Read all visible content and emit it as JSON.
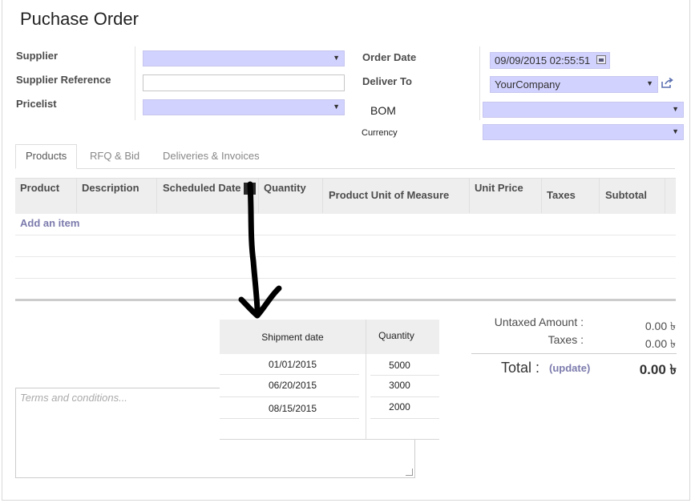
{
  "header": {
    "title": "Puchase Order"
  },
  "form": {
    "supplier_label": "Supplier",
    "supplier_ref_label": "Supplier Reference",
    "pricelist_label": "Pricelist",
    "order_date_label": "Order Date",
    "order_date_value": "09/09/2015 02:55:51",
    "deliver_to_label": "Deliver To",
    "deliver_to_value": "YourCompany",
    "bom_label": "BOM",
    "currency_label": "Currency"
  },
  "tabs": [
    "Products",
    "RFQ & Bid",
    "Deliveries & Invoices"
  ],
  "table": {
    "columns": [
      "Product",
      "Description",
      "Scheduled Date",
      "Quantity",
      "Product Unit of Measure",
      "Unit Price",
      "Taxes",
      "Subtotal"
    ],
    "add_item": "Add an item"
  },
  "terms_placeholder": "Terms and conditions...",
  "summary": {
    "untaxed_label": "Untaxed Amount :",
    "untaxed_value": "0.00 ৳",
    "taxes_label": "Taxes :",
    "taxes_value": "0.00 ৳",
    "total_label": "Total :",
    "update_link": "(update)",
    "total_value": "0.00 ৳"
  },
  "shipment": {
    "headers": [
      "Shipment date",
      "Quantity"
    ],
    "rows": [
      {
        "date": "01/01/2015",
        "qty": "5000"
      },
      {
        "date": "06/20/2015",
        "qty": "3000"
      },
      {
        "date": "08/15/2015",
        "qty": "2000"
      }
    ]
  },
  "colors": {
    "select_bg": "#d2d2ff",
    "link": "#7c7bad"
  }
}
